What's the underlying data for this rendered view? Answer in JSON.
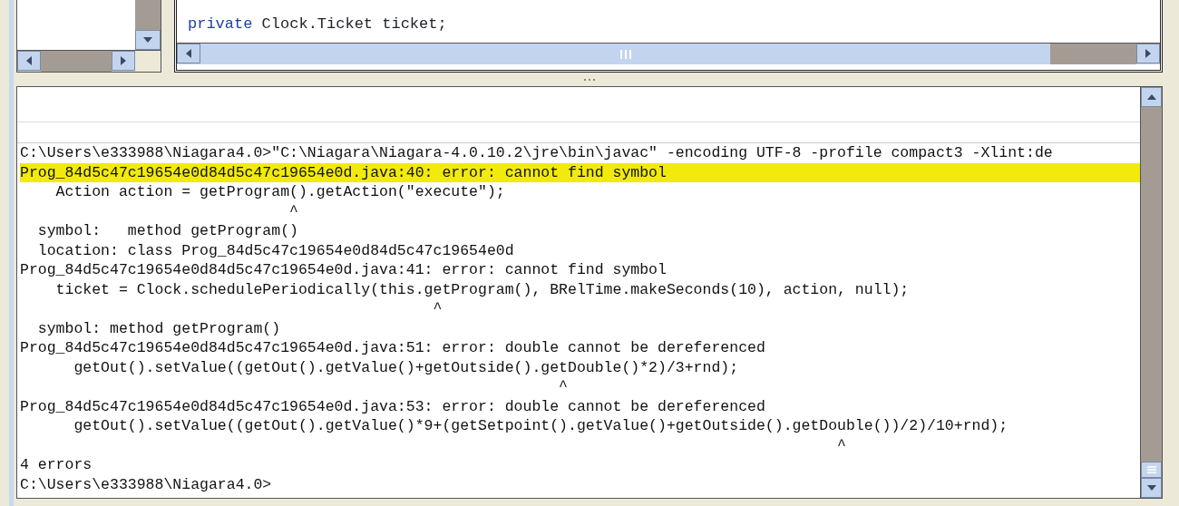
{
  "editor": {
    "code_line": [
      {
        "kind": "keyword",
        "text": "private"
      },
      {
        "kind": "plain",
        "text": " Clock.Ticket ticket;"
      }
    ]
  },
  "console": {
    "lines": [
      {
        "text": "C:\\Users\\e333988\\Niagara4.0>\"C:\\Niagara\\Niagara-4.0.10.2\\jre\\bin\\javac\" -encoding UTF-8 -profile compact3 -Xlint:de",
        "highlighted": false
      },
      {
        "text": "Prog_84d5c47c19654e0d84d5c47c19654e0d.java:40: error: cannot find symbol",
        "highlighted": true
      },
      {
        "text": "    Action action = getProgram().getAction(\"execute\");",
        "highlighted": false
      },
      {
        "text": "                              ^",
        "highlighted": false
      },
      {
        "text": "  symbol:   method getProgram()",
        "highlighted": false
      },
      {
        "text": "  location: class Prog_84d5c47c19654e0d84d5c47c19654e0d",
        "highlighted": false
      },
      {
        "text": "Prog_84d5c47c19654e0d84d5c47c19654e0d.java:41: error: cannot find symbol",
        "highlighted": false
      },
      {
        "text": "    ticket = Clock.schedulePeriodically(this.getProgram(), BRelTime.makeSeconds(10), action, null);",
        "highlighted": false
      },
      {
        "text": "                                              ^",
        "highlighted": false
      },
      {
        "text": "  symbol: method getProgram()",
        "highlighted": false
      },
      {
        "text": "Prog_84d5c47c19654e0d84d5c47c19654e0d.java:51: error: double cannot be dereferenced",
        "highlighted": false
      },
      {
        "text": "      getOut().setValue((getOut().getValue()+getOutside().getDouble()*2)/3+rnd);",
        "highlighted": false
      },
      {
        "text": "                                                            ^",
        "highlighted": false
      },
      {
        "text": "Prog_84d5c47c19654e0d84d5c47c19654e0d.java:53: error: double cannot be dereferenced",
        "highlighted": false
      },
      {
        "text": "      getOut().setValue((getOut().getValue()*9+(getSetpoint().getValue()+getOutside().getDouble())/2)/10+rnd);",
        "highlighted": false
      },
      {
        "text": "                                                                                           ^",
        "highlighted": false
      },
      {
        "text": "4 errors",
        "highlighted": false
      },
      {
        "text": "C:\\Users\\e333988\\Niagara4.0>",
        "highlighted": false
      }
    ]
  }
}
